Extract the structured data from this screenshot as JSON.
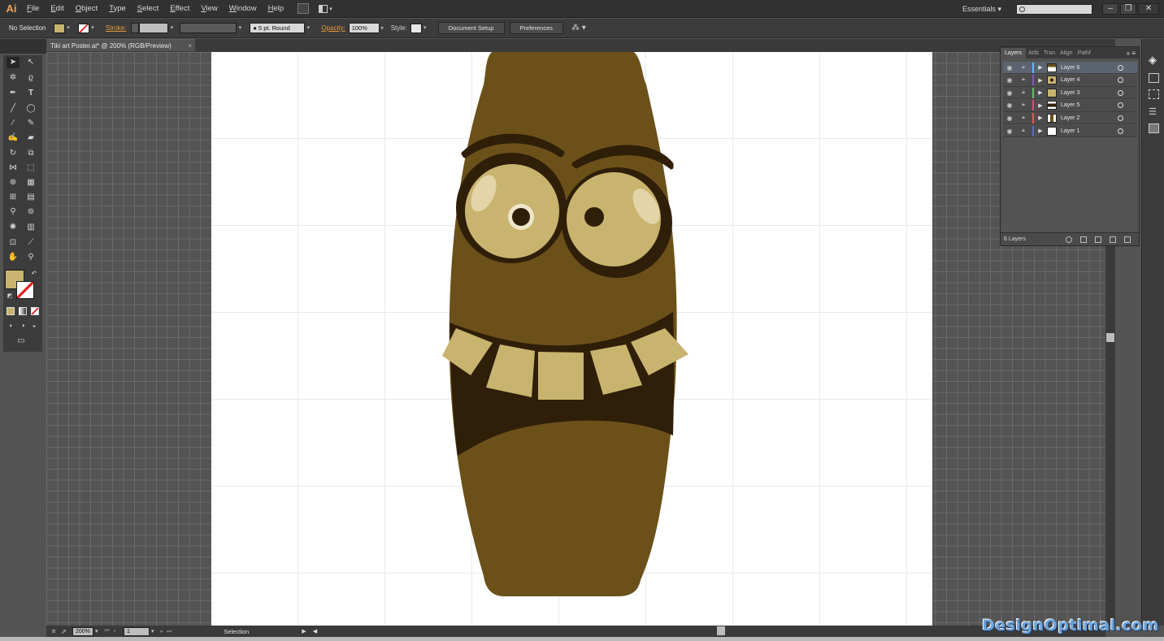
{
  "app": {
    "logo": "Ai"
  },
  "menu": [
    "File",
    "Edit",
    "Object",
    "Type",
    "Select",
    "Effect",
    "View",
    "Window",
    "Help"
  ],
  "workspace": {
    "label": "Essentials",
    "search_placeholder": ""
  },
  "control_bar": {
    "selection": "No Selection",
    "stroke_label": "Stroke:",
    "brush": "5 pt. Round",
    "opacity_label": "Opacity:",
    "opacity_value": "100%",
    "style_label": "Style:",
    "document_setup": "Document Setup",
    "preferences": "Preferences"
  },
  "document": {
    "tab_title": "Tiki art Poster.ai* @ 200% (RGB/Preview)"
  },
  "status": {
    "zoom": "200%",
    "page": "1",
    "tool": "Selection"
  },
  "layers_panel": {
    "tabs": [
      "Layers",
      "Artb",
      "Tran",
      "Align",
      "Pathf"
    ],
    "layers": [
      {
        "name": "Layer 6",
        "color": "#4fc3f7",
        "selected": true
      },
      {
        "name": "Layer 4",
        "color": "#7e57c2",
        "selected": false
      },
      {
        "name": "Layer 3",
        "color": "#66bb6a",
        "selected": false
      },
      {
        "name": "Layer 5",
        "color": "#ec407a",
        "selected": false
      },
      {
        "name": "Layer 2",
        "color": "#ef5350",
        "selected": false
      },
      {
        "name": "Layer 1",
        "color": "#5c6bc0",
        "selected": false
      }
    ],
    "count": "6 Layers"
  },
  "colors": {
    "fill": "#c8b46e",
    "body": "#6b5119",
    "dark": "#2f1e08",
    "teeth": "#c8b46e"
  },
  "watermark": "DesignOptimal.com"
}
